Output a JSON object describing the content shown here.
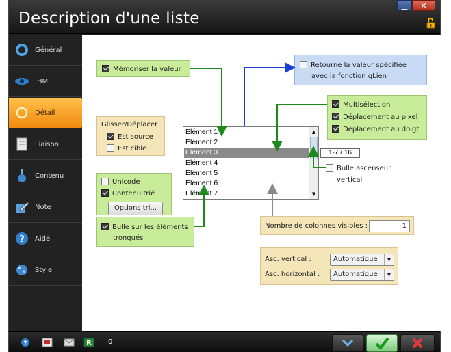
{
  "window": {
    "title": "Description d'une liste"
  },
  "sidebar": {
    "items": [
      {
        "label": "Général",
        "icon": "circle-ring-icon"
      },
      {
        "label": "IHM",
        "icon": "eye-icon"
      },
      {
        "label": "Détail",
        "icon": "ring-icon",
        "active": true
      },
      {
        "label": "Liaison",
        "icon": "page-icon"
      },
      {
        "label": "Contenu",
        "icon": "flask-icon"
      },
      {
        "label": "Note",
        "icon": "pencil-icon"
      },
      {
        "label": "Aide",
        "icon": "help-icon"
      },
      {
        "label": "Style",
        "icon": "palette-icon"
      }
    ]
  },
  "options": {
    "memoriser": "Mémoriser la valeur",
    "retourne": "Retourne la valeur spécifiée",
    "retourne2": "avec la fonction gLien",
    "multiselection": "Multisélection",
    "deplacement_pixel": "Déplacement au pixel",
    "deplacement_doigt": "Déplacement au doigt",
    "glisser_title": "Glisser/Déplacer",
    "est_source": "Est source",
    "est_cible": "Est cible",
    "unicode": "Unicode",
    "contenu_trie": "Contenu trié",
    "options_tri": "Options tri...",
    "bulle_elements": "Bulle sur les éléments",
    "bulle_elements2": "tronqués",
    "bulle_ascenseur": "Bulle ascenseur",
    "bulle_ascenseur2": "vertical",
    "nb_colonnes_label": "Nombre de colonnes visibles :",
    "nb_colonnes_value": "1",
    "asc_vertical_label": "Asc. vertical :",
    "asc_vertical_value": "Automatique",
    "asc_horizontal_label": "Asc. horizontal :",
    "asc_horizontal_value": "Automatique"
  },
  "list": {
    "items": [
      "Elément 1",
      "Elément 2",
      "Elément 3",
      "Elément 4",
      "Elément 5",
      "Elément 6",
      "Elément 7"
    ],
    "selected": "Elément 3",
    "counter": "1-7 / 16"
  },
  "bottom": {
    "count": "0"
  },
  "colors": {
    "accent_active": "#f5a623",
    "green_box": "#c8ec9a",
    "blue_box": "#c9daf5",
    "tan_box": "#f4e6b8",
    "arrow_green": "#1e8a1e",
    "arrow_blue": "#1a3fd6",
    "arrow_gray": "#8a8a8a"
  }
}
